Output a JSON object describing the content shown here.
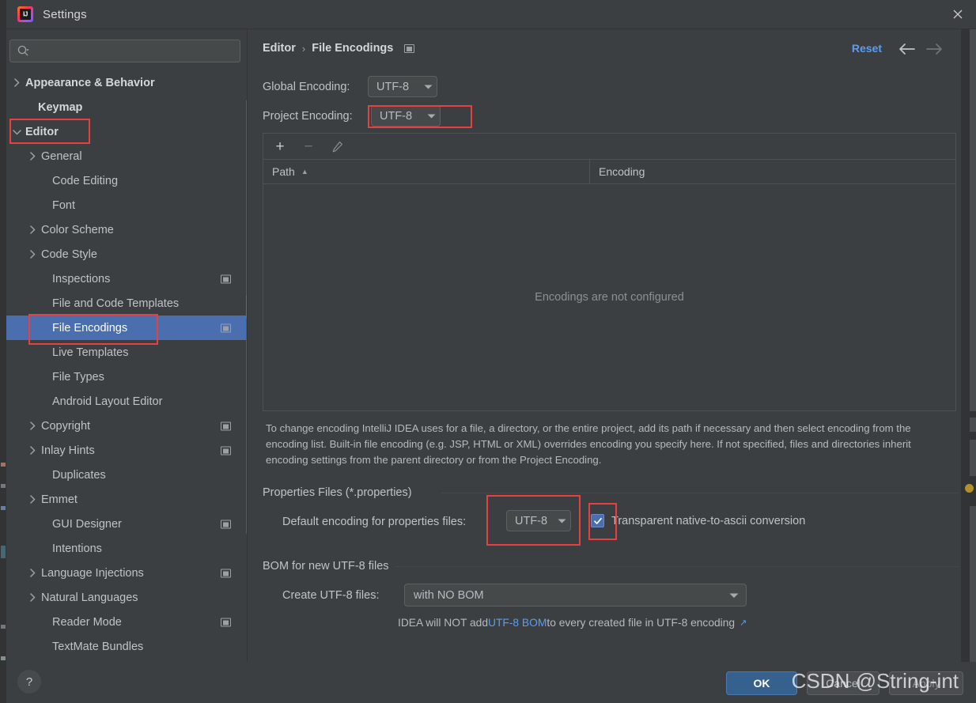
{
  "window": {
    "title": "Settings",
    "close_label": "×",
    "logo_text": "IJ"
  },
  "sidebar": {
    "search": {
      "placeholder": "",
      "value": "",
      "icon": "search-icon"
    },
    "items": [
      {
        "label": "Appearance & Behavior",
        "arrow": "›",
        "indent": 24,
        "bold": true,
        "badge": false,
        "selected": false
      },
      {
        "label": "Keymap",
        "arrow": "",
        "indent": 40,
        "bold": true,
        "badge": false,
        "selected": false
      },
      {
        "label": "Editor",
        "arrow": "∨",
        "indent": 24,
        "bold": true,
        "badge": false,
        "selected": false
      },
      {
        "label": "General",
        "arrow": "›",
        "indent": 44,
        "bold": false,
        "badge": false,
        "selected": false
      },
      {
        "label": "Code Editing",
        "arrow": "",
        "indent": 58,
        "bold": false,
        "badge": false,
        "selected": false
      },
      {
        "label": "Font",
        "arrow": "",
        "indent": 58,
        "bold": false,
        "badge": false,
        "selected": false
      },
      {
        "label": "Color Scheme",
        "arrow": "›",
        "indent": 44,
        "bold": false,
        "badge": false,
        "selected": false
      },
      {
        "label": "Code Style",
        "arrow": "›",
        "indent": 44,
        "bold": false,
        "badge": false,
        "selected": false
      },
      {
        "label": "Inspections",
        "arrow": "",
        "indent": 58,
        "bold": false,
        "badge": true,
        "selected": false
      },
      {
        "label": "File and Code Templates",
        "arrow": "",
        "indent": 58,
        "bold": false,
        "badge": false,
        "selected": false
      },
      {
        "label": "File Encodings",
        "arrow": "",
        "indent": 58,
        "bold": false,
        "badge": true,
        "selected": true
      },
      {
        "label": "Live Templates",
        "arrow": "",
        "indent": 58,
        "bold": false,
        "badge": false,
        "selected": false
      },
      {
        "label": "File Types",
        "arrow": "",
        "indent": 58,
        "bold": false,
        "badge": false,
        "selected": false
      },
      {
        "label": "Android Layout Editor",
        "arrow": "",
        "indent": 58,
        "bold": false,
        "badge": false,
        "selected": false
      },
      {
        "label": "Copyright",
        "arrow": "›",
        "indent": 44,
        "bold": false,
        "badge": true,
        "selected": false
      },
      {
        "label": "Inlay Hints",
        "arrow": "›",
        "indent": 44,
        "bold": false,
        "badge": true,
        "selected": false
      },
      {
        "label": "Duplicates",
        "arrow": "",
        "indent": 58,
        "bold": false,
        "badge": false,
        "selected": false
      },
      {
        "label": "Emmet",
        "arrow": "›",
        "indent": 44,
        "bold": false,
        "badge": false,
        "selected": false
      },
      {
        "label": "GUI Designer",
        "arrow": "",
        "indent": 58,
        "bold": false,
        "badge": true,
        "selected": false
      },
      {
        "label": "Intentions",
        "arrow": "",
        "indent": 58,
        "bold": false,
        "badge": false,
        "selected": false
      },
      {
        "label": "Language Injections",
        "arrow": "›",
        "indent": 44,
        "bold": false,
        "badge": true,
        "selected": false
      },
      {
        "label": "Natural Languages",
        "arrow": "›",
        "indent": 44,
        "bold": false,
        "badge": false,
        "selected": false
      },
      {
        "label": "Reader Mode",
        "arrow": "",
        "indent": 58,
        "bold": false,
        "badge": true,
        "selected": false
      },
      {
        "label": "TextMate Bundles",
        "arrow": "",
        "indent": 58,
        "bold": false,
        "badge": false,
        "selected": false
      }
    ]
  },
  "main": {
    "breadcrumb": {
      "parent": "Editor",
      "separator": "›",
      "current": "File Encodings"
    },
    "reset_label": "Reset",
    "global_encoding": {
      "label": "Global Encoding:",
      "value": "UTF-8"
    },
    "project_encoding": {
      "label": "Project Encoding:",
      "value": "UTF-8"
    },
    "table": {
      "toolbar": {
        "add": "+",
        "remove": "−",
        "edit": "pencil-icon"
      },
      "columns": [
        "Path",
        "Encoding"
      ],
      "sort_indicator": "▲",
      "empty_message": "Encodings are not configured",
      "rows": []
    },
    "description": "To change encoding IntelliJ IDEA uses for a file, a directory, or the entire project, add its path if necessary and then select encoding from the encoding list. Built-in file encoding (e.g. JSP, HTML or XML) overrides encoding you specify here. If not specified, files and directories inherit encoding settings from the parent directory or from the Project Encoding.",
    "properties_section": {
      "title": "Properties Files (*.properties)",
      "default_encoding_label": "Default encoding for properties files:",
      "default_encoding_value": "UTF-8",
      "transparent_label": "Transparent native-to-ascii conversion",
      "transparent_checked": true,
      "check_glyph": "✓"
    },
    "bom_section": {
      "title": "BOM for new UTF-8 files",
      "create_label": "Create UTF-8 files:",
      "create_value": "with NO BOM",
      "hint_prefix": "IDEA will NOT add ",
      "hint_link": "UTF-8 BOM",
      "hint_suffix": " to every created file in UTF-8 encoding",
      "external_arrow": "↗"
    }
  },
  "footer": {
    "help_label": "?",
    "ok_label": "OK",
    "cancel_label": "Cancel",
    "apply_label": "Apply"
  },
  "watermark": "CSDN @String-int",
  "colors": {
    "accent_blue": "#4b6eaf",
    "link_blue": "#589df6",
    "panel_bg": "#3c3f41",
    "annotation_red": "#e84040",
    "ok_button": "#36618f"
  }
}
